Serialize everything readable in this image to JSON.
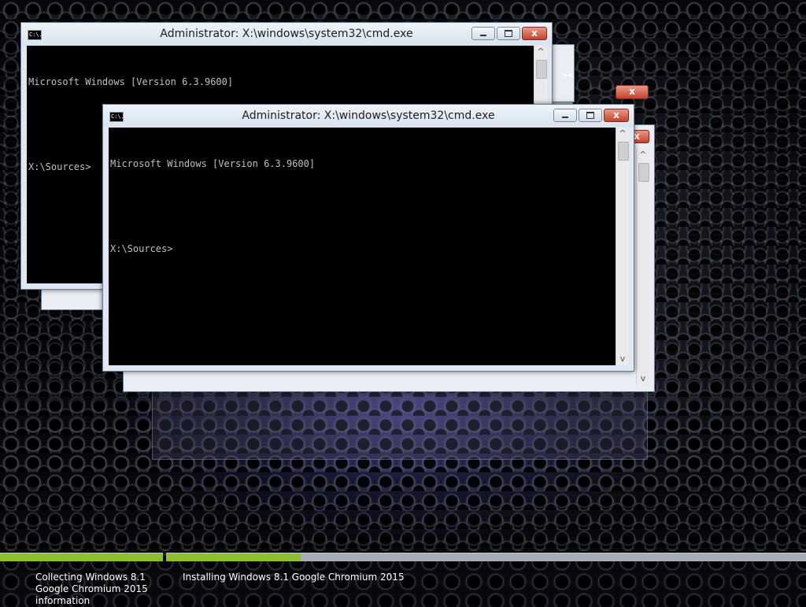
{
  "windows": {
    "back": {
      "title": "Administrator: X:\\windows\\system32\\cmd.exe",
      "lines": [
        "Microsoft Windows [Version 6.3.9600]",
        "",
        "X:\\Sources>"
      ]
    },
    "front": {
      "title": "Administrator: X:\\windows\\system32\\cmd.exe",
      "lines": [
        "Microsoft Windows [Version 6.3.9600]",
        "",
        "X:\\Sources>"
      ]
    },
    "close_glyph": "x",
    "app_icon_text": "C:\\."
  },
  "setup": {
    "steps": [
      {
        "label": "Collecting Windows 8.1 Google Chromium 2015 information",
        "progress": 1.0
      },
      {
        "label": "Installing Windows 8.1 Google Chromium 2015",
        "progress": 0.21
      }
    ],
    "accent_color": "#8cbf2c"
  }
}
